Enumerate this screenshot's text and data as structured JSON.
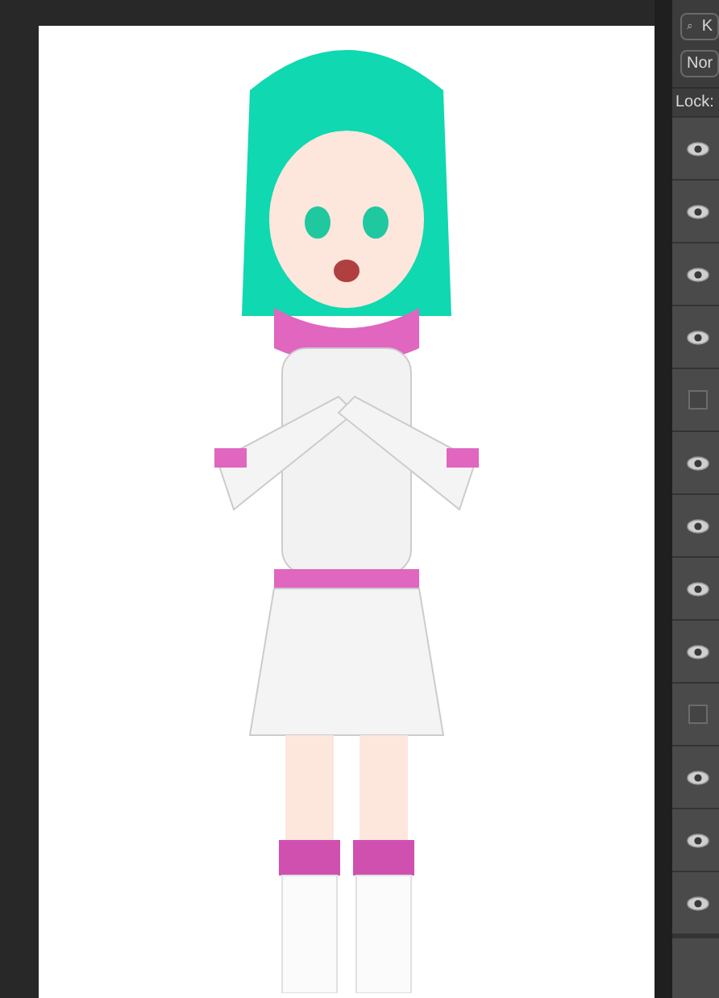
{
  "layers_panel": {
    "search": {
      "value": "K"
    },
    "blend_mode": {
      "value": "Nor"
    },
    "lock_label": "Lock:",
    "layers": [
      {
        "visible": true
      },
      {
        "visible": true
      },
      {
        "visible": true
      },
      {
        "visible": true
      },
      {
        "visible": false
      },
      {
        "visible": true
      },
      {
        "visible": true
      },
      {
        "visible": true
      },
      {
        "visible": true
      },
      {
        "visible": false
      },
      {
        "visible": true
      },
      {
        "visible": true
      },
      {
        "visible": true
      }
    ]
  }
}
